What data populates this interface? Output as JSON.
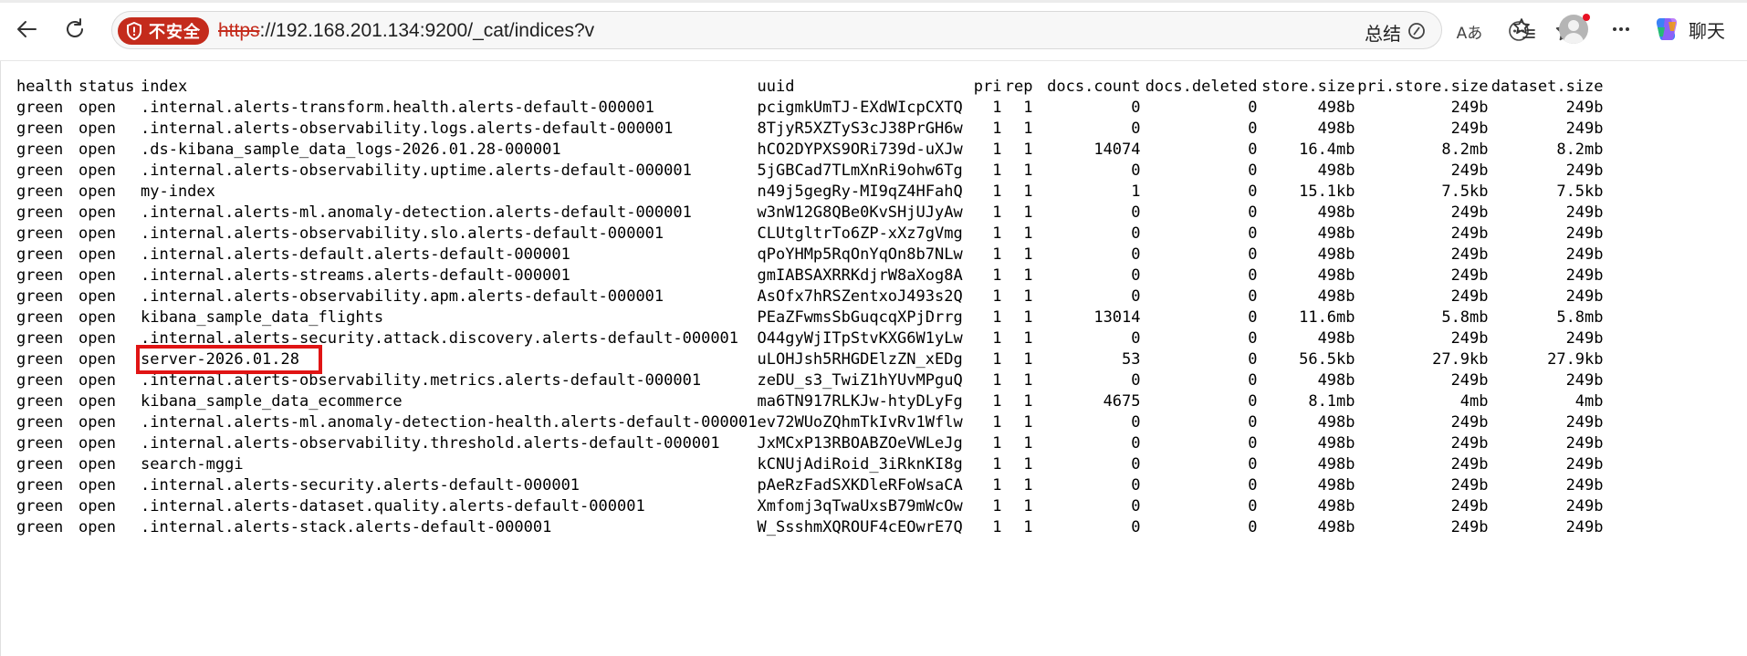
{
  "browser": {
    "security_label": "不安全",
    "url_scheme": "https",
    "url_rest": "://192.168.201.134:9200/_cat/indices?v",
    "summary_label": "总结",
    "chat_label": "聊天",
    "warning_color": "#c42b1c"
  },
  "table": {
    "headers": [
      "health",
      "status",
      "index",
      "uuid",
      "pri",
      "rep",
      "docs.count",
      "docs.deleted",
      "store.size",
      "pri.store.size",
      "dataset.size"
    ],
    "rows": [
      [
        "green",
        "open",
        ".internal.alerts-transform.health.alerts-default-000001",
        "pcigmkUmTJ-EXdWIcpCXTQ",
        "1",
        "1",
        "0",
        "0",
        "498b",
        "249b",
        "249b"
      ],
      [
        "green",
        "open",
        ".internal.alerts-observability.logs.alerts-default-000001",
        "8TjyR5XZTyS3cJ38PrGH6w",
        "1",
        "1",
        "0",
        "0",
        "498b",
        "249b",
        "249b"
      ],
      [
        "green",
        "open",
        ".ds-kibana_sample_data_logs-2026.01.28-000001",
        "hCO2DYPXS9ORi739d-uXJw",
        "1",
        "1",
        "14074",
        "0",
        "16.4mb",
        "8.2mb",
        "8.2mb"
      ],
      [
        "green",
        "open",
        ".internal.alerts-observability.uptime.alerts-default-000001",
        "5jGBCad7TLmXnRi9ohw6Tg",
        "1",
        "1",
        "0",
        "0",
        "498b",
        "249b",
        "249b"
      ],
      [
        "green",
        "open",
        "my-index",
        "n49j5gegRy-MI9qZ4HFahQ",
        "1",
        "1",
        "1",
        "0",
        "15.1kb",
        "7.5kb",
        "7.5kb"
      ],
      [
        "green",
        "open",
        ".internal.alerts-ml.anomaly-detection.alerts-default-000001",
        "w3nW12G8QBe0KvSHjUJyAw",
        "1",
        "1",
        "0",
        "0",
        "498b",
        "249b",
        "249b"
      ],
      [
        "green",
        "open",
        ".internal.alerts-observability.slo.alerts-default-000001",
        "CLUtgltrTo6ZP-xXz7gVmg",
        "1",
        "1",
        "0",
        "0",
        "498b",
        "249b",
        "249b"
      ],
      [
        "green",
        "open",
        ".internal.alerts-default.alerts-default-000001",
        "qPoYHMp5RqOnYqOn8b7NLw",
        "1",
        "1",
        "0",
        "0",
        "498b",
        "249b",
        "249b"
      ],
      [
        "green",
        "open",
        ".internal.alerts-streams.alerts-default-000001",
        "gmIABSAXRRKdjrW8aXog8A",
        "1",
        "1",
        "0",
        "0",
        "498b",
        "249b",
        "249b"
      ],
      [
        "green",
        "open",
        ".internal.alerts-observability.apm.alerts-default-000001",
        "AsOfx7hRSZentxoJ493s2Q",
        "1",
        "1",
        "0",
        "0",
        "498b",
        "249b",
        "249b"
      ],
      [
        "green",
        "open",
        "kibana_sample_data_flights",
        "PEaZFwmsSbGuqcqXPjDrrg",
        "1",
        "1",
        "13014",
        "0",
        "11.6mb",
        "5.8mb",
        "5.8mb"
      ],
      [
        "green",
        "open",
        ".internal.alerts-security.attack.discovery.alerts-default-000001",
        "O44gyWjITpStvKXG6W1yLw",
        "1",
        "1",
        "0",
        "0",
        "498b",
        "249b",
        "249b"
      ],
      [
        "green",
        "open",
        "server-2026.01.28",
        "uLOHJsh5RHGDElzZN_xEDg",
        "1",
        "1",
        "53",
        "0",
        "56.5kb",
        "27.9kb",
        "27.9kb"
      ],
      [
        "green",
        "open",
        ".internal.alerts-observability.metrics.alerts-default-000001",
        "zeDU_s3_TwiZ1hYUvMPguQ",
        "1",
        "1",
        "0",
        "0",
        "498b",
        "249b",
        "249b"
      ],
      [
        "green",
        "open",
        "kibana_sample_data_ecommerce",
        "ma6TN917RLKJw-htyDLyFg",
        "1",
        "1",
        "4675",
        "0",
        "8.1mb",
        "4mb",
        "4mb"
      ],
      [
        "green",
        "open",
        ".internal.alerts-ml.anomaly-detection-health.alerts-default-000001",
        "ev72WUoZQhmTkIvRv1Wflw",
        "1",
        "1",
        "0",
        "0",
        "498b",
        "249b",
        "249b"
      ],
      [
        "green",
        "open",
        ".internal.alerts-observability.threshold.alerts-default-000001",
        "JxMCxP13RBOABZOeVWLeJg",
        "1",
        "1",
        "0",
        "0",
        "498b",
        "249b",
        "249b"
      ],
      [
        "green",
        "open",
        "search-mggi",
        "kCNUjAdiRoid_3iRknKI8g",
        "1",
        "1",
        "0",
        "0",
        "498b",
        "249b",
        "249b"
      ],
      [
        "green",
        "open",
        ".internal.alerts-security.alerts-default-000001",
        "pAeRzFadSXKDleRFoWsaCA",
        "1",
        "1",
        "0",
        "0",
        "498b",
        "249b",
        "249b"
      ],
      [
        "green",
        "open",
        ".internal.alerts-dataset.quality.alerts-default-000001",
        "Xmfomj3qTwaUxsB79mWcOw",
        "1",
        "1",
        "0",
        "0",
        "498b",
        "249b",
        "249b"
      ],
      [
        "green",
        "open",
        ".internal.alerts-stack.alerts-default-000001",
        "W_SsshmXQROUF4cEOwrE7Q",
        "1",
        "1",
        "0",
        "0",
        "498b",
        "249b",
        "249b"
      ]
    ],
    "highlighted_index": "server-2026.01.28",
    "highlight_color": "#e01414"
  }
}
